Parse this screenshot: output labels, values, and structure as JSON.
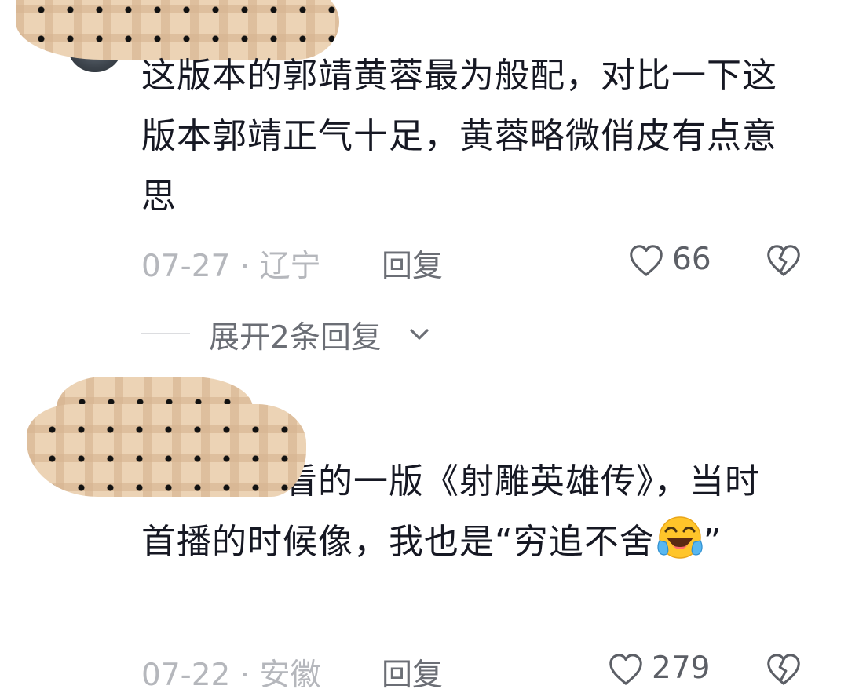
{
  "comments": [
    {
      "text": "这版本的郭靖黄蓉最为般配，对比一下这版本郭靖正气十足，黄蓉略微俏皮有点意思",
      "date": "07-27 · 辽宁",
      "reply_label": "回复",
      "likes": "66",
      "expand_label": "展开2条回复"
    },
    {
      "text": "翻拍最好看的一版《射雕英雄传》，当时首播的时候像，我也是“穷追不舍",
      "text_after_emoji": "”",
      "emoji_icon": "laughing-crying-emoji-icon",
      "date": "07-22 · 安徽",
      "reply_label": "回复",
      "likes": "279"
    }
  ],
  "colors": {
    "text": "#161823",
    "meta": "#b5b7bc",
    "action": "#6b6e75",
    "censor": "#ecd3b5"
  }
}
